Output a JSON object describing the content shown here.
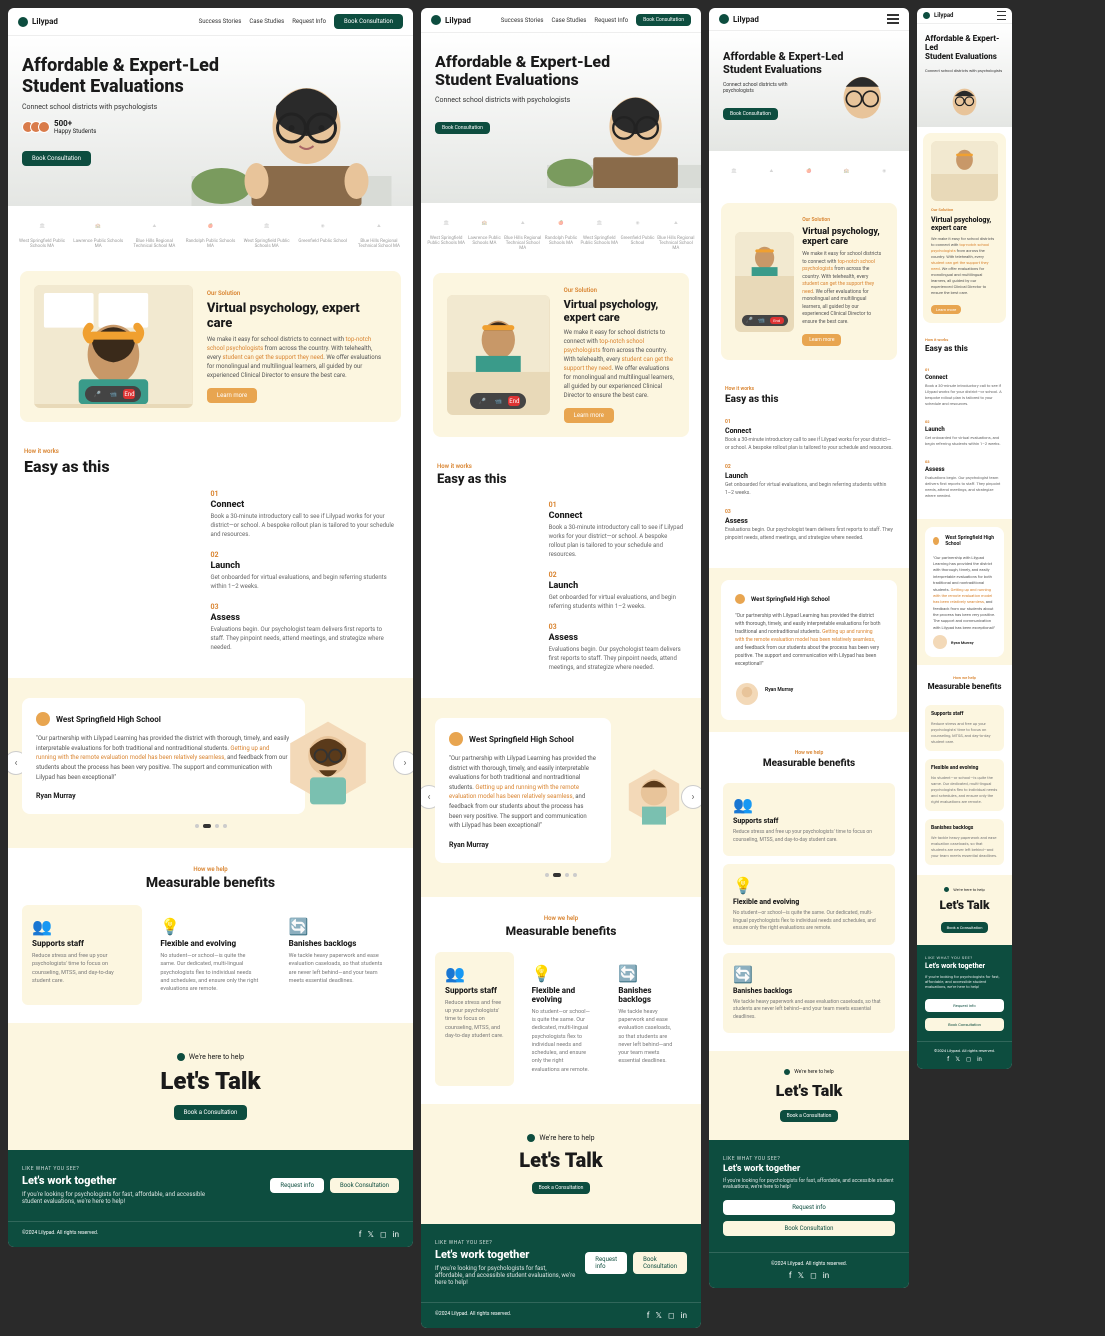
{
  "brand": "Lilypad",
  "nav": {
    "links": [
      "Success Stories",
      "Case Studies",
      "Request Info"
    ],
    "cta": "Book Consultation"
  },
  "hero": {
    "title_1": "Affordable & Expert-Led",
    "title_2": "Student Evaluations",
    "subtitle": "Connect school districts with psychologists",
    "stat_number": "500+",
    "stat_label": "Happy Students",
    "cta": "Book Consultation"
  },
  "schools": [
    "West Springfield Public Schools MA",
    "Lawrence Public Schools MA",
    "Blue Hills Regional Technical School MA",
    "Randolph Public Schools MA",
    "West Springfield Public Schools MA",
    "Greenfield Public School",
    "Blue Hills Regional Technical School MA"
  ],
  "solution": {
    "eyebrow": "Our Solution",
    "title": "Virtual psychology, expert care",
    "body_pre": "We make it easy for school districts to connect with ",
    "body_link1": "top-notch school psychologists",
    "body_mid": " from across the country. With telehealth, every ",
    "body_link2": "student can get the support they need",
    "body_post": ". We offer evaluations for monolingual and multilingual learners, all guided by our experienced Clinical Director to ensure the best care.",
    "cta": "Learn more",
    "controls": {
      "end": "End"
    }
  },
  "how": {
    "eyebrow": "How it works",
    "title": "Easy as this",
    "steps": [
      {
        "n": "01",
        "title": "Connect",
        "desc": "Book a 30-minute introductory call to see if Lilypad works for your district—or school. A bespoke rollout plan is tailored to your schedule and resources."
      },
      {
        "n": "02",
        "title": "Launch",
        "desc": "Get onboarded for virtual evaluations, and begin referring students within 1–2 weeks."
      },
      {
        "n": "03",
        "title": "Assess",
        "desc": "Evaluations begin. Our psychologist team delivers first reports to staff. They pinpoint needs, attend meetings, and strategize where needed."
      }
    ]
  },
  "testimonial": {
    "school": "West Springfield High School",
    "quote_pre": "\"Our partnership with Lilypad Learning has provided the district with thorough, timely, and easily interpretable evaluations for both traditional and nontraditional students. ",
    "quote_hl": "Getting up and running with the remote evaluation model has been relatively seamless,",
    "quote_post": " and feedback from our students about the process has been very positive. The support and communication with Lilypad has been exceptional!\"",
    "author": "Ryan Murray"
  },
  "benefits": {
    "eyebrow": "How we help",
    "title": "Measurable benefits",
    "items": [
      {
        "title": "Supports staff",
        "desc": "Reduce stress and free up your psychologists' time to focus on counseling, MTSS, and day-to-day student care."
      },
      {
        "title": "Flexible and evolving",
        "desc": "No student—or school—is quite the same. Our dedicated, multi-lingual psychologists flex to individual needs and schedules, and ensure only the right evaluations are remote."
      },
      {
        "title": "Banishes backlogs",
        "desc": "We tackle heavy paperwork and ease evaluation caseloads, so that students are never left behind—and your team meets essential deadlines."
      }
    ]
  },
  "talk": {
    "badge": "We're here to help",
    "title": "Let's Talk",
    "cta": "Book a Consultation"
  },
  "footer_cta": {
    "eyebrow": "LIKE WHAT YOU SEE?",
    "title": "Let's work together",
    "body": "If you're looking for psychologists for fast, affordable, and accessible student evaluations, we're here to help!",
    "btn1": "Request info",
    "btn2": "Book Consultation"
  },
  "footer": {
    "copyright": "©2024 Lilypad. All rights reserved."
  }
}
